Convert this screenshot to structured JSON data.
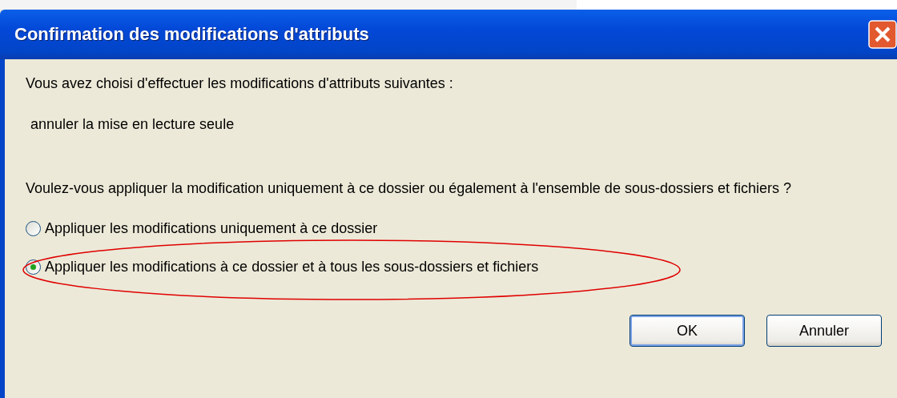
{
  "window": {
    "title": "Confirmation des modifications d'attributs"
  },
  "message": "Vous avez choisi d'effectuer les modifications d'attributs suivantes :",
  "change": "annuler la mise en lecture seule",
  "question": "Voulez-vous appliquer la modification uniquement à ce dossier ou également à l'ensemble de sous-dossiers et fichiers ?",
  "options": [
    {
      "label": "Appliquer les modifications uniquement à ce dossier",
      "selected": false,
      "circled": false
    },
    {
      "label": "Appliquer les modifications à ce dossier et à tous les sous-dossiers et fichiers",
      "selected": true,
      "circled": true
    }
  ],
  "buttons": [
    {
      "label": "OK",
      "default": true
    },
    {
      "label": "Annuler",
      "default": false
    }
  ]
}
